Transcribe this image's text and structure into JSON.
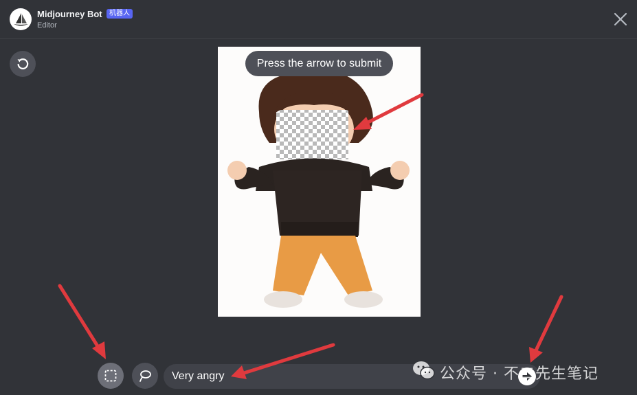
{
  "header": {
    "bot_name": "Midjourney Bot",
    "badge": "机器人",
    "subtitle": "Editor"
  },
  "editor": {
    "tooltip": "Press the arrow to submit",
    "prompt_value": "Very angry"
  },
  "watermark": {
    "text": "公众号 · 不二先生笔记"
  },
  "colors": {
    "background": "#313338",
    "button": "#4e5058",
    "input": "#404249",
    "badge": "#5865f2",
    "annotation_arrow": "#e03a3e"
  },
  "icons": {
    "close": "close-icon",
    "reset": "undo-icon",
    "rect_select": "rectangle-select-icon",
    "lasso": "lasso-icon",
    "submit": "arrow-right-circle-icon",
    "logo": "sailboat-logo-icon",
    "wechat": "wechat-icon"
  }
}
